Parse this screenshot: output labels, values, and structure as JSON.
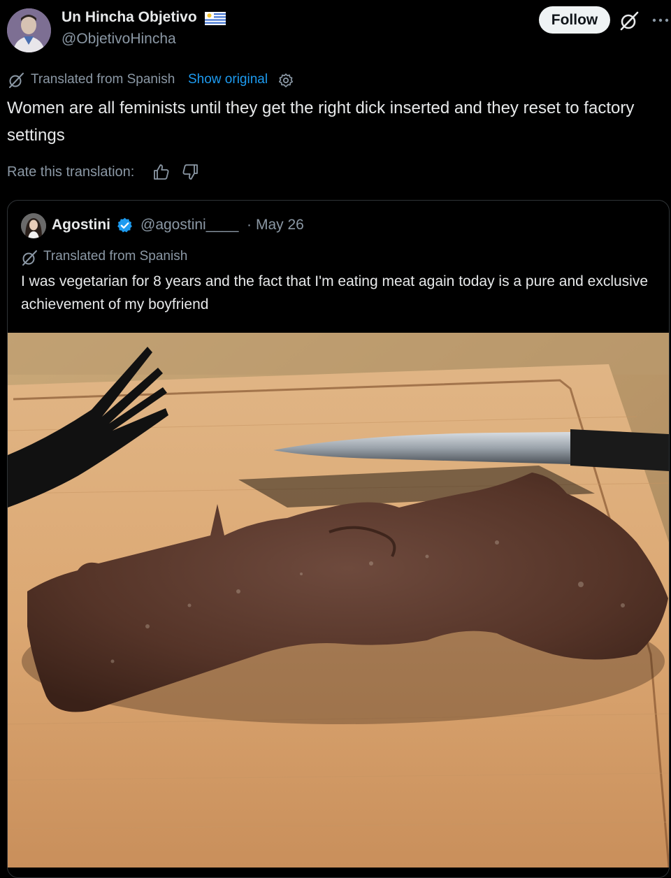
{
  "post": {
    "author": {
      "display_name": "Un Hincha Objetivo",
      "handle": "@ObjetivoHincha",
      "flag": "uruguay-flag"
    },
    "follow_label": "Follow",
    "translation": {
      "label": "Translated from Spanish",
      "show_original": "Show original"
    },
    "text": "Women are all feminists until they get the right dick inserted and they reset to factory settings",
    "rate_label": "Rate this translation:"
  },
  "quote": {
    "author": {
      "display_name": "Agostini",
      "handle": "@agostini____",
      "verified": true
    },
    "separator": "·",
    "date": "May 26",
    "translation_label": "Translated from Spanish",
    "text": "I was vegetarian for 8 years and the fact that I'm eating meat again today is a pure and exclusive achievement of my boyfriend",
    "photo": "steak-on-cutting-board-with-fork-and-knife"
  },
  "colors": {
    "background": "#000000",
    "text_primary": "#e7e9ea",
    "text_secondary": "#8b98a5",
    "link": "#1d9bf0",
    "verified": "#1d9bf0",
    "follow_button_bg": "#eff3f4",
    "card_border": "#2f3336"
  }
}
